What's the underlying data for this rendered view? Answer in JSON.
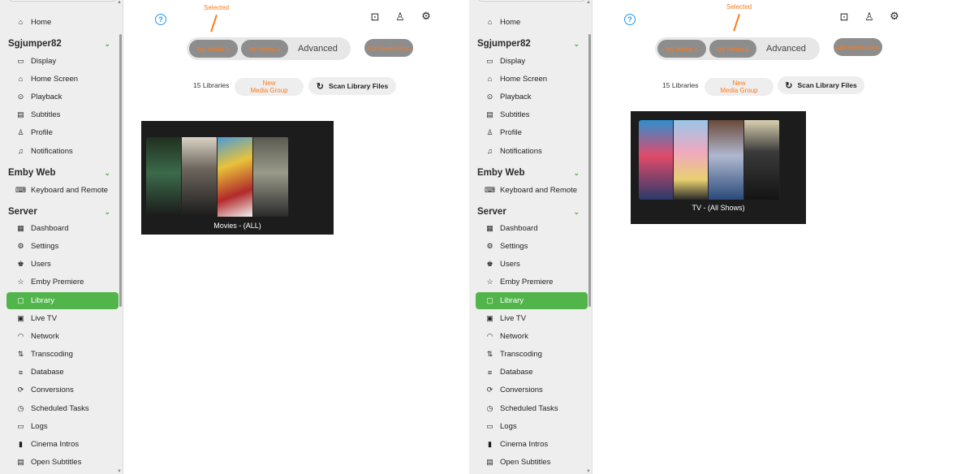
{
  "sidebar": {
    "home": {
      "label": "Home",
      "icon": "home-icon"
    },
    "user_section": "Sgjumper82",
    "user_items": [
      {
        "label": "Display",
        "icon": "display-icon",
        "glyph": "▭"
      },
      {
        "label": "Home Screen",
        "icon": "home-icon",
        "glyph": "⌂"
      },
      {
        "label": "Playback",
        "icon": "play-icon",
        "glyph": "⊙"
      },
      {
        "label": "Subtitles",
        "icon": "subtitles-icon",
        "glyph": "▤"
      },
      {
        "label": "Profile",
        "icon": "profile-icon",
        "glyph": "♙"
      },
      {
        "label": "Notifications",
        "icon": "bell-icon",
        "glyph": "♫"
      }
    ],
    "web_section": "Emby Web",
    "web_items": [
      {
        "label": "Keyboard and Remote",
        "icon": "keyboard-icon",
        "glyph": "⌨"
      }
    ],
    "server_section": "Server",
    "server_items": [
      {
        "label": "Dashboard",
        "icon": "dashboard-icon",
        "glyph": "▦"
      },
      {
        "label": "Settings",
        "icon": "gear-icon",
        "glyph": "⚙"
      },
      {
        "label": "Users",
        "icon": "users-icon",
        "glyph": "♚"
      },
      {
        "label": "Emby Premiere",
        "icon": "star-icon",
        "glyph": "☆"
      },
      {
        "label": "Library",
        "icon": "folder-icon",
        "glyph": "▢",
        "selected": true
      },
      {
        "label": "Live TV",
        "icon": "tv-icon",
        "glyph": "▣"
      },
      {
        "label": "Network",
        "icon": "wifi-icon",
        "glyph": "◠"
      },
      {
        "label": "Transcoding",
        "icon": "transcoding-icon",
        "glyph": "⇅"
      },
      {
        "label": "Database",
        "icon": "database-icon",
        "glyph": "≡"
      },
      {
        "label": "Conversions",
        "icon": "conversions-icon",
        "glyph": "⟳"
      },
      {
        "label": "Scheduled Tasks",
        "icon": "clock-icon",
        "glyph": "◷"
      },
      {
        "label": "Logs",
        "icon": "logs-folder-icon",
        "glyph": "▭"
      },
      {
        "label": "Cinema Intros",
        "icon": "film-icon",
        "glyph": "▮"
      },
      {
        "label": "Open Subtitles",
        "icon": "subtitles-icon",
        "glyph": "▤"
      }
    ]
  },
  "panels": [
    {
      "annotation": "Selected",
      "tabs": [
        "My Media 1",
        "My Media 2"
      ],
      "tab_advanced": "Advanced",
      "add_group": "Add Media Grou",
      "library_count": "15 Libraries",
      "new_group_line1": "New",
      "new_group_line2": "Media Group",
      "scan_label": "Scan Library Files",
      "card_title": "Movies - (ALL)"
    },
    {
      "annotation": "Selected",
      "tabs": [
        "My Media 1",
        "My Media 2"
      ],
      "tab_advanced": "Advanced",
      "add_group": "Add Media Grou",
      "library_count": "15 Libraries",
      "new_group_line1": "New",
      "new_group_line2": "Media Group",
      "scan_label": "Scan Library Files",
      "card_title": "TV - (All Shows)"
    }
  ],
  "colors": {
    "accent_green": "#52b54b",
    "annotation_orange": "#ff7a1a",
    "help_blue": "#2196f3"
  }
}
